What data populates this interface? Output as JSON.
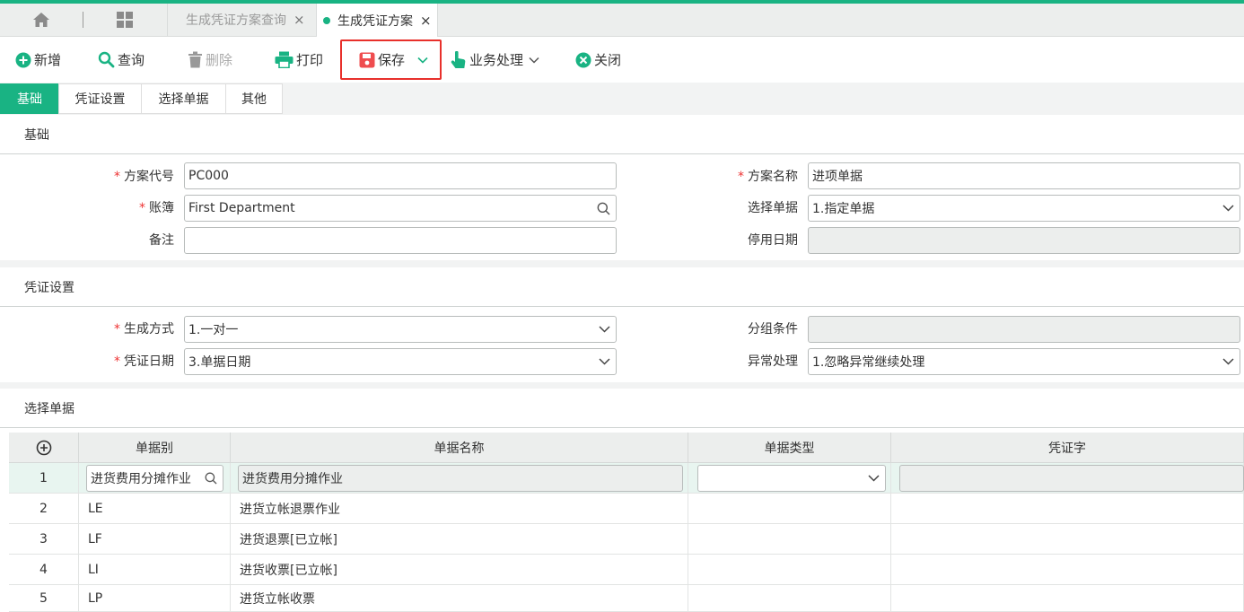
{
  "tabs": {
    "home_icon": "home-icon",
    "grid_icon": "apps-grid-icon",
    "items": [
      {
        "label": "生成凭证方案查询",
        "close": "×"
      },
      {
        "label": "生成凭证方案",
        "close": "×"
      }
    ]
  },
  "toolbar": {
    "add": "新增",
    "query": "查询",
    "delete": "删除",
    "print": "打印",
    "save": "保存",
    "business": "业务处理",
    "close": "关闭"
  },
  "subtabs": [
    "基础",
    "凭证设置",
    "选择单据",
    "其他"
  ],
  "basic": {
    "title": "基础",
    "scheme_code_label": "方案代号",
    "scheme_code": "PC000",
    "scheme_name_label": "方案名称",
    "scheme_name": "进项单据",
    "ledger_label": "账簿",
    "ledger": "First Department",
    "select_doc_label": "选择单据",
    "select_doc": "1.指定单据",
    "remark_label": "备注",
    "remark": "",
    "disable_date_label": "停用日期",
    "disable_date": ""
  },
  "voucher": {
    "title": "凭证设置",
    "gen_method_label": "生成方式",
    "gen_method": "1.一对一",
    "group_cond_label": "分组条件",
    "group_cond": "",
    "voucher_date_label": "凭证日期",
    "voucher_date": "3.单据日期",
    "exception_label": "异常处理",
    "exception": "1.忽略异常继续处理"
  },
  "docs": {
    "title": "选择单据",
    "columns": [
      "单据别",
      "单据名称",
      "单据类型",
      "凭证字"
    ],
    "rows": [
      {
        "no": "1",
        "code": "进货费用分摊作业",
        "name": "进货费用分摊作业",
        "type": "",
        "word": ""
      },
      {
        "no": "2",
        "code": "LE",
        "name": "进货立帐退票作业",
        "type": "",
        "word": ""
      },
      {
        "no": "3",
        "code": "LF",
        "name": "进货退票[已立帐]",
        "type": "",
        "word": ""
      },
      {
        "no": "4",
        "code": "LI",
        "name": "进货收票[已立帐]",
        "type": "",
        "word": ""
      },
      {
        "no": "5",
        "code": "LP",
        "name": "进货立帐收票",
        "type": "",
        "word": ""
      }
    ]
  },
  "colors": {
    "accent": "#19b383",
    "highlight": "#e8302b",
    "required": "#ee3333"
  }
}
